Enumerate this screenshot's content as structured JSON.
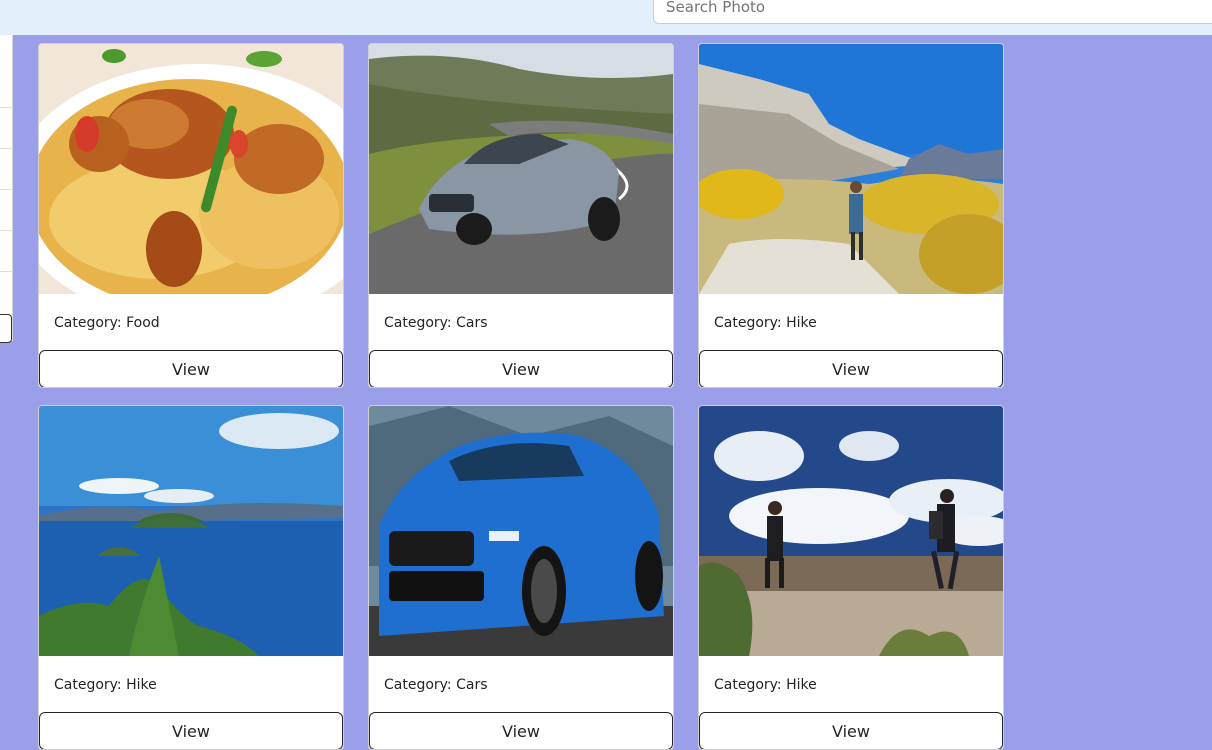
{
  "search": {
    "placeholder": "Search Photo",
    "value": ""
  },
  "cards": [
    {
      "category_label": "Category: Food",
      "button_label": "View",
      "image": "chicken-biryani-photo"
    },
    {
      "category_label": "Category: Cars",
      "button_label": "View",
      "image": "grey-sports-car-photo"
    },
    {
      "category_label": "Category: Hike",
      "button_label": "View",
      "image": "mountain-hiker-photo"
    },
    {
      "category_label": "Category: Hike",
      "button_label": "View",
      "image": "sea-islands-photo"
    },
    {
      "category_label": "Category: Cars",
      "button_label": "View",
      "image": "blue-suv-photo"
    },
    {
      "category_label": "Category: Hike",
      "button_label": "View",
      "image": "two-hikers-photo"
    }
  ],
  "colors": {
    "page_background": "#9b9fe9",
    "header_background": "#e3effa",
    "card_background": "#ffffff",
    "button_border": "#212529"
  }
}
